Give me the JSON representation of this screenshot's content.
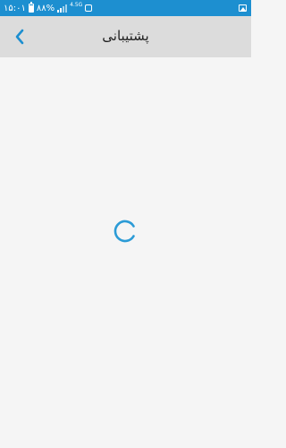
{
  "status_bar": {
    "time": "۱۵:۰۱",
    "battery": "۸۸%",
    "network": "4.5G",
    "icons": [
      "battery-icon",
      "cell-signal-icon",
      "alarm-icon",
      "image-icon"
    ]
  },
  "app_bar": {
    "title": "پشتیبانی",
    "back_icon": "chevron-left-icon"
  },
  "content": {
    "loading": true,
    "spinner_icon": "loading-spinner"
  },
  "colors": {
    "status_bar": "#1d8fd0",
    "app_bar": "#dcdcdc",
    "background": "#f5f5f5",
    "accent": "#2b9bd6"
  }
}
